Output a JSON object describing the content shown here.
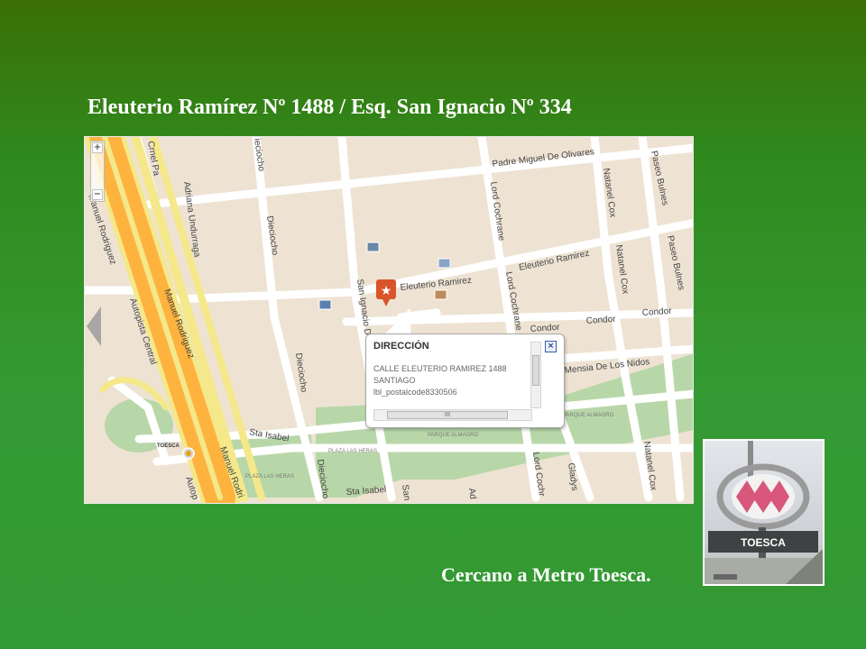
{
  "slide": {
    "title": "Eleuterio Ramírez Nº 1488 / Esq. San Ignacio Nº 334",
    "caption": "Cercano a Metro Toesca."
  },
  "map": {
    "streets": {
      "crnel_pa": "Crnel Pa",
      "manuel_rodriguez_left": "Manuel Rodriguez",
      "adriana_undurraga": "Adriana Undurraga",
      "dieciocho_top": "ieciocho",
      "dieciocho_mid": "Dieciocho",
      "dieciocho_low": "Dieciocho",
      "dieciocho_bottom": "Dieciocho",
      "autopista_central": "Autopista Central",
      "manuel_rodriguez_center": "Manuel Rodriguez",
      "manuel_rodri_bottom": "Manuel Rodri",
      "autop_bottom": "Autop",
      "padre_miguel_de_olivares": "Padre Miguel De Olivares",
      "lord_cochrane_top": "Lord Cochrane",
      "lord_cochrane_mid": "Lord Cochrane",
      "lord_cochr_bottom": "Lord Cochr",
      "natanel_cox_top": "Natanel Cox",
      "natanel_cox_mid": "Natanel Cox",
      "natanel_cox_bottom": "Natanel Cox",
      "paseo_bulnes_top": "Paseo Bulnes",
      "paseo_bulnes_mid": "Paseo Bulnes",
      "eleuterio_ramirez_left": "Eleuterio Ramirez",
      "eleuterio_ramirez_right": "Eleuterio Ramirez",
      "san_ignacio": "San Ignacio D",
      "san_bottom": "San",
      "condor_1": "Condor",
      "condor_2": "Condor",
      "condor_3": "Condor",
      "mensia_de_los_nidos": "Mensia De Los Nidos",
      "sta_isabel_left": "Sta Isabel",
      "sta_isabel_bottom": "Sta Isabel",
      "gladys": "Gladys",
      "ad": "Ad"
    },
    "places": {
      "toesca": "TOESCA",
      "plaza_las_heras": "PLAZA LAS HERAS",
      "plaza_las_heras_2": "PLAZA LAS HERAS",
      "parque_almagro": "PARQUE ALMAGRO",
      "parque_almagro_2": "PARQUE ALMAGRO"
    },
    "zoom": {
      "plus": "+",
      "minus": "−"
    },
    "popup": {
      "title": "DIRECCIÓN",
      "line1": "CALLE ELEUTERIO RAMIREZ 1488",
      "line2": "SANTIAGO",
      "line3": "lbl_postalcode8330506",
      "close": "×",
      "scroll_grip": "III"
    }
  },
  "metro_sign": {
    "label": "TOESCA",
    "logo_color": "#d8567a"
  }
}
